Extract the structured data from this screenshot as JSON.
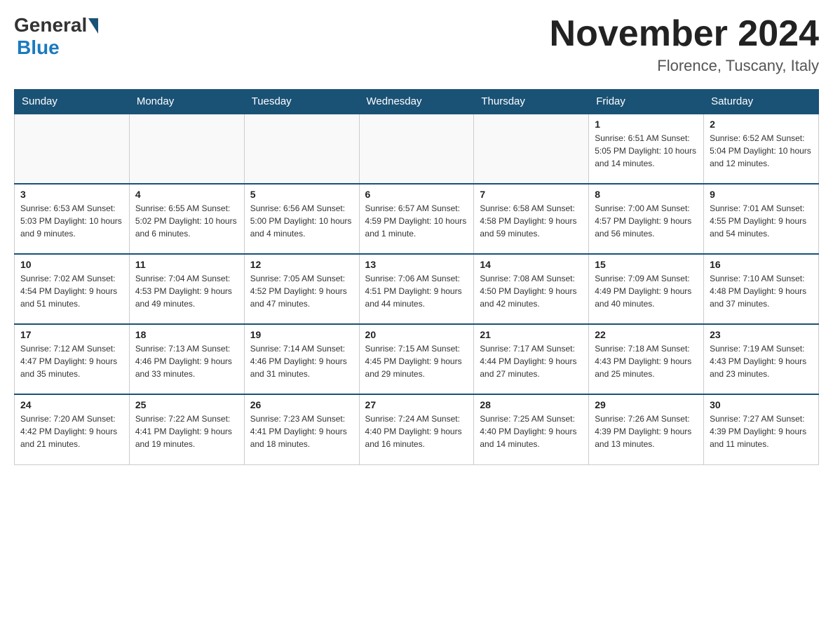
{
  "header": {
    "logo_general": "General",
    "logo_blue": "Blue",
    "month_title": "November 2024",
    "location": "Florence, Tuscany, Italy"
  },
  "days_of_week": [
    "Sunday",
    "Monday",
    "Tuesday",
    "Wednesday",
    "Thursday",
    "Friday",
    "Saturday"
  ],
  "weeks": [
    [
      {
        "day": "",
        "info": ""
      },
      {
        "day": "",
        "info": ""
      },
      {
        "day": "",
        "info": ""
      },
      {
        "day": "",
        "info": ""
      },
      {
        "day": "",
        "info": ""
      },
      {
        "day": "1",
        "info": "Sunrise: 6:51 AM\nSunset: 5:05 PM\nDaylight: 10 hours\nand 14 minutes."
      },
      {
        "day": "2",
        "info": "Sunrise: 6:52 AM\nSunset: 5:04 PM\nDaylight: 10 hours\nand 12 minutes."
      }
    ],
    [
      {
        "day": "3",
        "info": "Sunrise: 6:53 AM\nSunset: 5:03 PM\nDaylight: 10 hours\nand 9 minutes."
      },
      {
        "day": "4",
        "info": "Sunrise: 6:55 AM\nSunset: 5:02 PM\nDaylight: 10 hours\nand 6 minutes."
      },
      {
        "day": "5",
        "info": "Sunrise: 6:56 AM\nSunset: 5:00 PM\nDaylight: 10 hours\nand 4 minutes."
      },
      {
        "day": "6",
        "info": "Sunrise: 6:57 AM\nSunset: 4:59 PM\nDaylight: 10 hours\nand 1 minute."
      },
      {
        "day": "7",
        "info": "Sunrise: 6:58 AM\nSunset: 4:58 PM\nDaylight: 9 hours\nand 59 minutes."
      },
      {
        "day": "8",
        "info": "Sunrise: 7:00 AM\nSunset: 4:57 PM\nDaylight: 9 hours\nand 56 minutes."
      },
      {
        "day": "9",
        "info": "Sunrise: 7:01 AM\nSunset: 4:55 PM\nDaylight: 9 hours\nand 54 minutes."
      }
    ],
    [
      {
        "day": "10",
        "info": "Sunrise: 7:02 AM\nSunset: 4:54 PM\nDaylight: 9 hours\nand 51 minutes."
      },
      {
        "day": "11",
        "info": "Sunrise: 7:04 AM\nSunset: 4:53 PM\nDaylight: 9 hours\nand 49 minutes."
      },
      {
        "day": "12",
        "info": "Sunrise: 7:05 AM\nSunset: 4:52 PM\nDaylight: 9 hours\nand 47 minutes."
      },
      {
        "day": "13",
        "info": "Sunrise: 7:06 AM\nSunset: 4:51 PM\nDaylight: 9 hours\nand 44 minutes."
      },
      {
        "day": "14",
        "info": "Sunrise: 7:08 AM\nSunset: 4:50 PM\nDaylight: 9 hours\nand 42 minutes."
      },
      {
        "day": "15",
        "info": "Sunrise: 7:09 AM\nSunset: 4:49 PM\nDaylight: 9 hours\nand 40 minutes."
      },
      {
        "day": "16",
        "info": "Sunrise: 7:10 AM\nSunset: 4:48 PM\nDaylight: 9 hours\nand 37 minutes."
      }
    ],
    [
      {
        "day": "17",
        "info": "Sunrise: 7:12 AM\nSunset: 4:47 PM\nDaylight: 9 hours\nand 35 minutes."
      },
      {
        "day": "18",
        "info": "Sunrise: 7:13 AM\nSunset: 4:46 PM\nDaylight: 9 hours\nand 33 minutes."
      },
      {
        "day": "19",
        "info": "Sunrise: 7:14 AM\nSunset: 4:46 PM\nDaylight: 9 hours\nand 31 minutes."
      },
      {
        "day": "20",
        "info": "Sunrise: 7:15 AM\nSunset: 4:45 PM\nDaylight: 9 hours\nand 29 minutes."
      },
      {
        "day": "21",
        "info": "Sunrise: 7:17 AM\nSunset: 4:44 PM\nDaylight: 9 hours\nand 27 minutes."
      },
      {
        "day": "22",
        "info": "Sunrise: 7:18 AM\nSunset: 4:43 PM\nDaylight: 9 hours\nand 25 minutes."
      },
      {
        "day": "23",
        "info": "Sunrise: 7:19 AM\nSunset: 4:43 PM\nDaylight: 9 hours\nand 23 minutes."
      }
    ],
    [
      {
        "day": "24",
        "info": "Sunrise: 7:20 AM\nSunset: 4:42 PM\nDaylight: 9 hours\nand 21 minutes."
      },
      {
        "day": "25",
        "info": "Sunrise: 7:22 AM\nSunset: 4:41 PM\nDaylight: 9 hours\nand 19 minutes."
      },
      {
        "day": "26",
        "info": "Sunrise: 7:23 AM\nSunset: 4:41 PM\nDaylight: 9 hours\nand 18 minutes."
      },
      {
        "day": "27",
        "info": "Sunrise: 7:24 AM\nSunset: 4:40 PM\nDaylight: 9 hours\nand 16 minutes."
      },
      {
        "day": "28",
        "info": "Sunrise: 7:25 AM\nSunset: 4:40 PM\nDaylight: 9 hours\nand 14 minutes."
      },
      {
        "day": "29",
        "info": "Sunrise: 7:26 AM\nSunset: 4:39 PM\nDaylight: 9 hours\nand 13 minutes."
      },
      {
        "day": "30",
        "info": "Sunrise: 7:27 AM\nSunset: 4:39 PM\nDaylight: 9 hours\nand 11 minutes."
      }
    ]
  ]
}
